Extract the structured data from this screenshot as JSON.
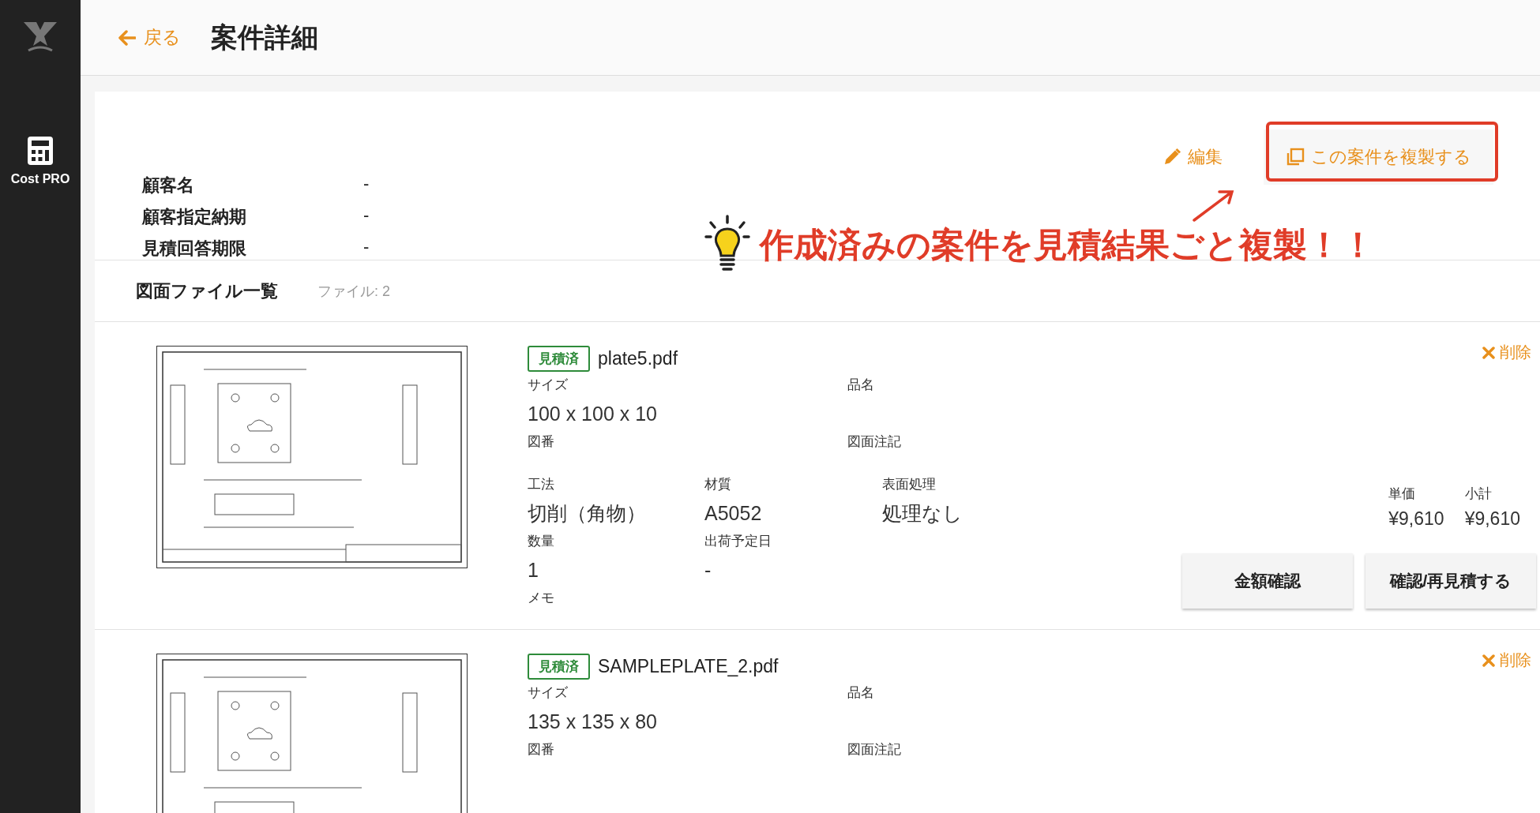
{
  "sidebar": {
    "app_name": "Cost PRO"
  },
  "header": {
    "back": "戻る",
    "title": "案件詳細"
  },
  "actions": {
    "edit": "編集",
    "duplicate": "この案件を複製する"
  },
  "info": [
    {
      "label": "顧客名",
      "value": "-"
    },
    {
      "label": "顧客指定納期",
      "value": "-"
    },
    {
      "label": "見積回答期限",
      "value": "-"
    }
  ],
  "files_section": {
    "title": "図面ファイル一覧",
    "count": "ファイル: 2"
  },
  "annotation": {
    "text": "作成済みの案件を見積結果ごと複製！！"
  },
  "files": [
    {
      "status": "見積済",
      "filename": "plate5.pdf",
      "delete": "削除",
      "size": {
        "label": "サイズ",
        "value": "100 x 100 x 10"
      },
      "item_name": {
        "label": "品名"
      },
      "drawing_no": {
        "label": "図番"
      },
      "notes": {
        "label": "図面注記"
      },
      "method": {
        "label": "工法",
        "value": "切削（角物）"
      },
      "material": {
        "label": "材質",
        "value": "A5052"
      },
      "surface": {
        "label": "表面処理",
        "value": "処理なし"
      },
      "quantity": {
        "label": "数量",
        "value": "1"
      },
      "ship_date": {
        "label": "出荷予定日",
        "value": "-"
      },
      "memo": {
        "label": "メモ"
      },
      "unit_price": {
        "label": "単価",
        "value": "¥9,610"
      },
      "subtotal": {
        "label": "小計",
        "value": "¥9,610"
      },
      "buttons": [
        "金額確認",
        "確認/再見積する"
      ]
    },
    {
      "status": "見積済",
      "filename": "SAMPLEPLATE_2.pdf",
      "delete": "削除",
      "size": {
        "label": "サイズ",
        "value": "135 x 135 x 80"
      },
      "item_name": {
        "label": "品名"
      },
      "drawing_no": {
        "label": "図番"
      },
      "notes": {
        "label": "図面注記"
      }
    }
  ]
}
